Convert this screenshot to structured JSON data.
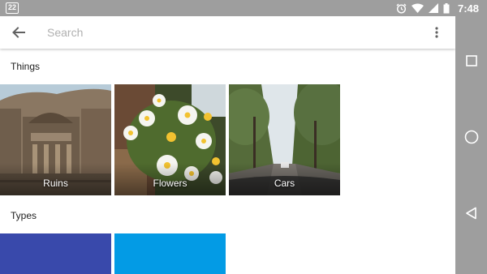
{
  "status_bar": {
    "notification_count": "22",
    "time": "7:48",
    "background": "#9e9e9e"
  },
  "search": {
    "placeholder": "Search",
    "value": ""
  },
  "sections": {
    "things": {
      "title": "Things",
      "tiles": [
        {
          "label": "Ruins"
        },
        {
          "label": "Flowers"
        },
        {
          "label": "Cars"
        }
      ]
    },
    "types": {
      "title": "Types",
      "tiles": [
        {
          "color": "#3949ab"
        },
        {
          "color": "#039be5"
        }
      ]
    }
  },
  "icons": {
    "back": "arrow-back-icon",
    "more": "more-vert-icon",
    "nav_recents": "square-icon",
    "nav_home": "circle-icon",
    "nav_back": "triangle-back-icon"
  }
}
